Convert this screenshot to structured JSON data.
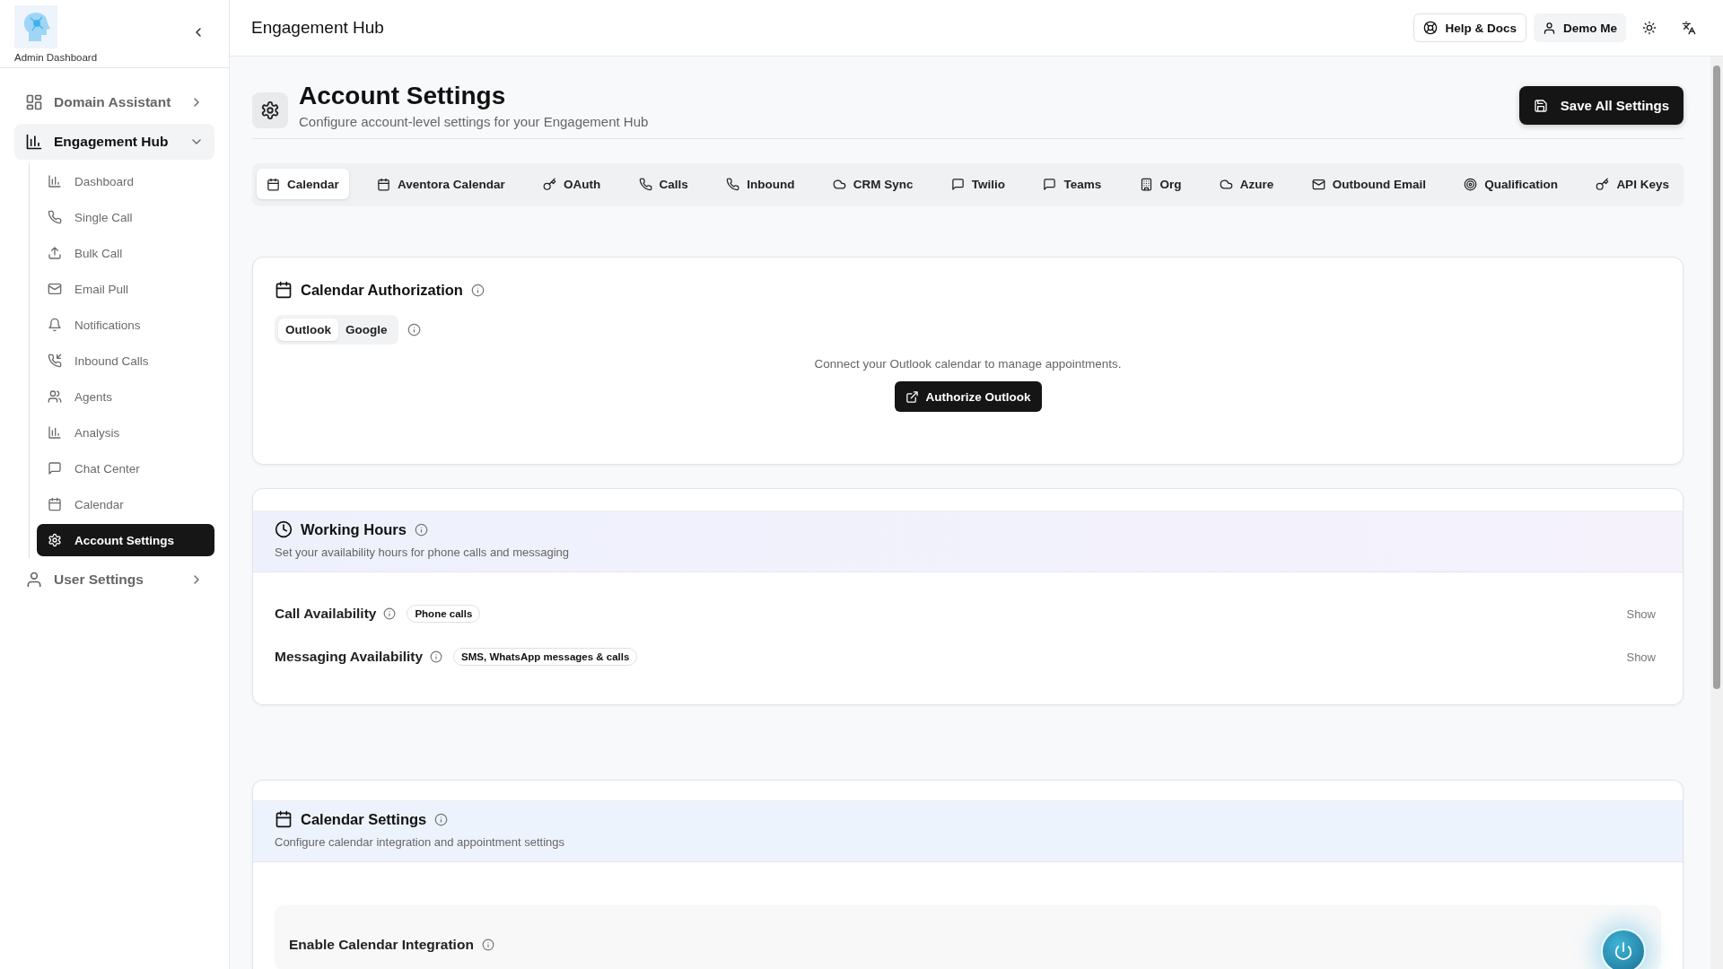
{
  "sidebar": {
    "logo_caption": "Admin Dashboard",
    "items": [
      {
        "label": "Domain Assistant",
        "selected": false,
        "expanded": false
      },
      {
        "label": "Engagement Hub",
        "selected": true,
        "expanded": true,
        "children": [
          {
            "label": "Dashboard",
            "selected": false
          },
          {
            "label": "Single Call",
            "selected": false
          },
          {
            "label": "Bulk Call",
            "selected": false
          },
          {
            "label": "Email Pull",
            "selected": false
          },
          {
            "label": "Notifications",
            "selected": false
          },
          {
            "label": "Inbound Calls",
            "selected": false
          },
          {
            "label": "Agents",
            "selected": false
          },
          {
            "label": "Analysis",
            "selected": false
          },
          {
            "label": "Chat Center",
            "selected": false
          },
          {
            "label": "Calendar",
            "selected": false
          },
          {
            "label": "Account Settings",
            "selected": true
          }
        ]
      },
      {
        "label": "User Settings",
        "selected": false,
        "expanded": false
      }
    ]
  },
  "header": {
    "title": "Engagement Hub",
    "help_button": "Help & Docs",
    "demo_button": "Demo Me"
  },
  "page": {
    "title": "Account Settings",
    "subtitle": "Configure account-level settings for your Engagement Hub",
    "save_button": "Save All Settings"
  },
  "tabs": [
    {
      "label": "Calendar",
      "selected": true
    },
    {
      "label": "Aventora Calendar",
      "selected": false
    },
    {
      "label": "OAuth",
      "selected": false
    },
    {
      "label": "Calls",
      "selected": false
    },
    {
      "label": "Inbound",
      "selected": false
    },
    {
      "label": "CRM Sync",
      "selected": false
    },
    {
      "label": "Twilio",
      "selected": false
    },
    {
      "label": "Teams",
      "selected": false
    },
    {
      "label": "Org",
      "selected": false
    },
    {
      "label": "Azure",
      "selected": false
    },
    {
      "label": "Outbound Email",
      "selected": false
    },
    {
      "label": "Qualification",
      "selected": false
    },
    {
      "label": "API Keys",
      "selected": false
    }
  ],
  "calendar_authorization": {
    "title": "Calendar Authorization",
    "providers": [
      {
        "label": "Outlook",
        "selected": true
      },
      {
        "label": "Google",
        "selected": false
      }
    ],
    "message": "Connect your Outlook calendar to manage appointments.",
    "button": "Authorize Outlook"
  },
  "working_hours": {
    "title": "Working Hours",
    "subtitle": "Set your availability hours for phone calls and messaging",
    "rows": [
      {
        "label": "Call Availability",
        "tag": "Phone calls",
        "action": "Show"
      },
      {
        "label": "Messaging Availability",
        "tag": "SMS, WhatsApp messages & calls",
        "action": "Show"
      }
    ]
  },
  "calendar_settings": {
    "title": "Calendar Settings",
    "subtitle": "Configure calendar integration and appointment settings",
    "toggle_label": "Enable Calendar Integration"
  }
}
